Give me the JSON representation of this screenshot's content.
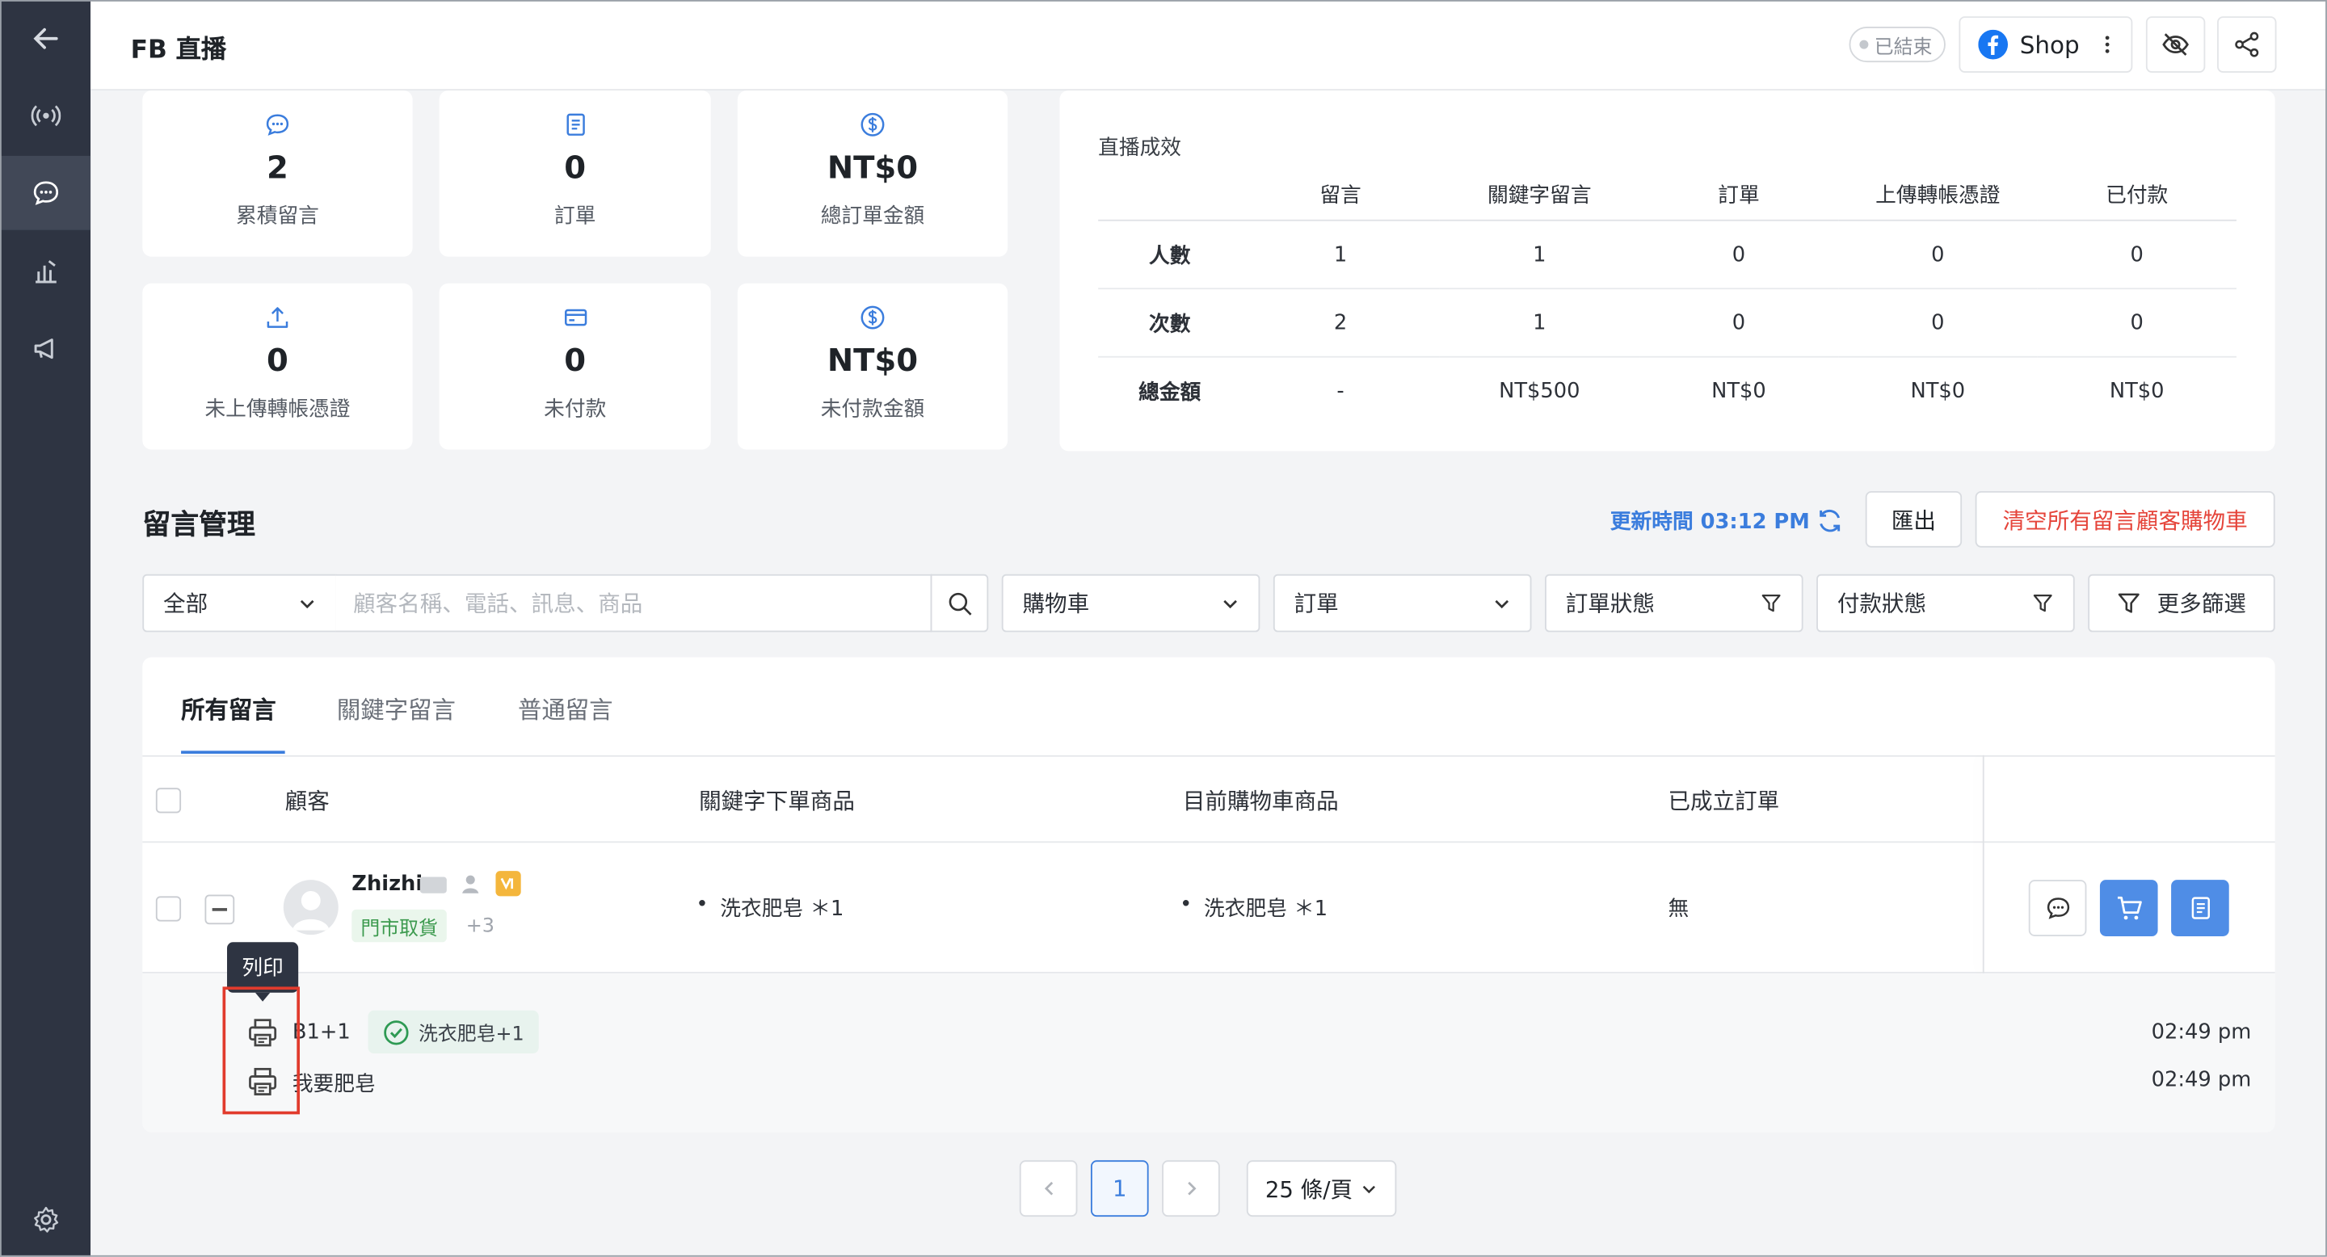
{
  "header": {
    "title": "FB 直播",
    "status_badge": "已結束",
    "shop_label": "Shop"
  },
  "stats": [
    {
      "value": "2",
      "label": "累積留言",
      "icon": "chat-bubble-icon"
    },
    {
      "value": "0",
      "label": "訂單",
      "icon": "clipboard-icon"
    },
    {
      "value": "NT$0",
      "label": "總訂單金額",
      "icon": "dollar-circle-icon"
    },
    {
      "value": "0",
      "label": "未上傳轉帳憑證",
      "icon": "upload-icon"
    },
    {
      "value": "0",
      "label": "未付款",
      "icon": "credit-card-icon"
    },
    {
      "value": "NT$0",
      "label": "未付款金額",
      "icon": "dollar-circle-icon"
    }
  ],
  "performance": {
    "title": "直播成效",
    "columns": [
      "",
      "留言",
      "關鍵字留言",
      "訂單",
      "上傳轉帳憑證",
      "已付款"
    ],
    "rows": [
      [
        "人數",
        "1",
        "1",
        "0",
        "0",
        "0"
      ],
      [
        "次數",
        "2",
        "1",
        "0",
        "0",
        "0"
      ],
      [
        "總金額",
        "-",
        "NT$500",
        "NT$0",
        "NT$0",
        "NT$0"
      ]
    ]
  },
  "comments": {
    "title": "留言管理",
    "updated": "更新時間 03:12 PM",
    "export_label": "匯出",
    "clear_label": "清空所有留言顧客購物車",
    "filters": {
      "scope": "全部",
      "search_placeholder": "顧客名稱、電話、訊息、商品",
      "cart": "購物車",
      "order": "訂單",
      "order_status": "訂單狀態",
      "payment_status": "付款狀態",
      "more": "更多篩選"
    },
    "tabs": [
      "所有留言",
      "關鍵字留言",
      "普通留言"
    ],
    "columns": [
      "顧客",
      "關鍵字下單商品",
      "目前購物車商品",
      "已成立訂單"
    ],
    "row": {
      "name": "Zhizhi",
      "tag": "門市取貨",
      "more_tags": "+3",
      "keyword_item": "洗衣肥皂 ＊1",
      "cart_item": "洗衣肥皂 ＊1",
      "order": "無"
    },
    "messages": [
      {
        "text": "B1+1",
        "badge": "洗衣肥皂+1",
        "time": "02:49 pm"
      },
      {
        "text": "我要肥皂",
        "time": "02:49 pm"
      }
    ],
    "tooltip": "列印",
    "pagination": {
      "current": "1",
      "per_page": "25 條/頁"
    }
  }
}
